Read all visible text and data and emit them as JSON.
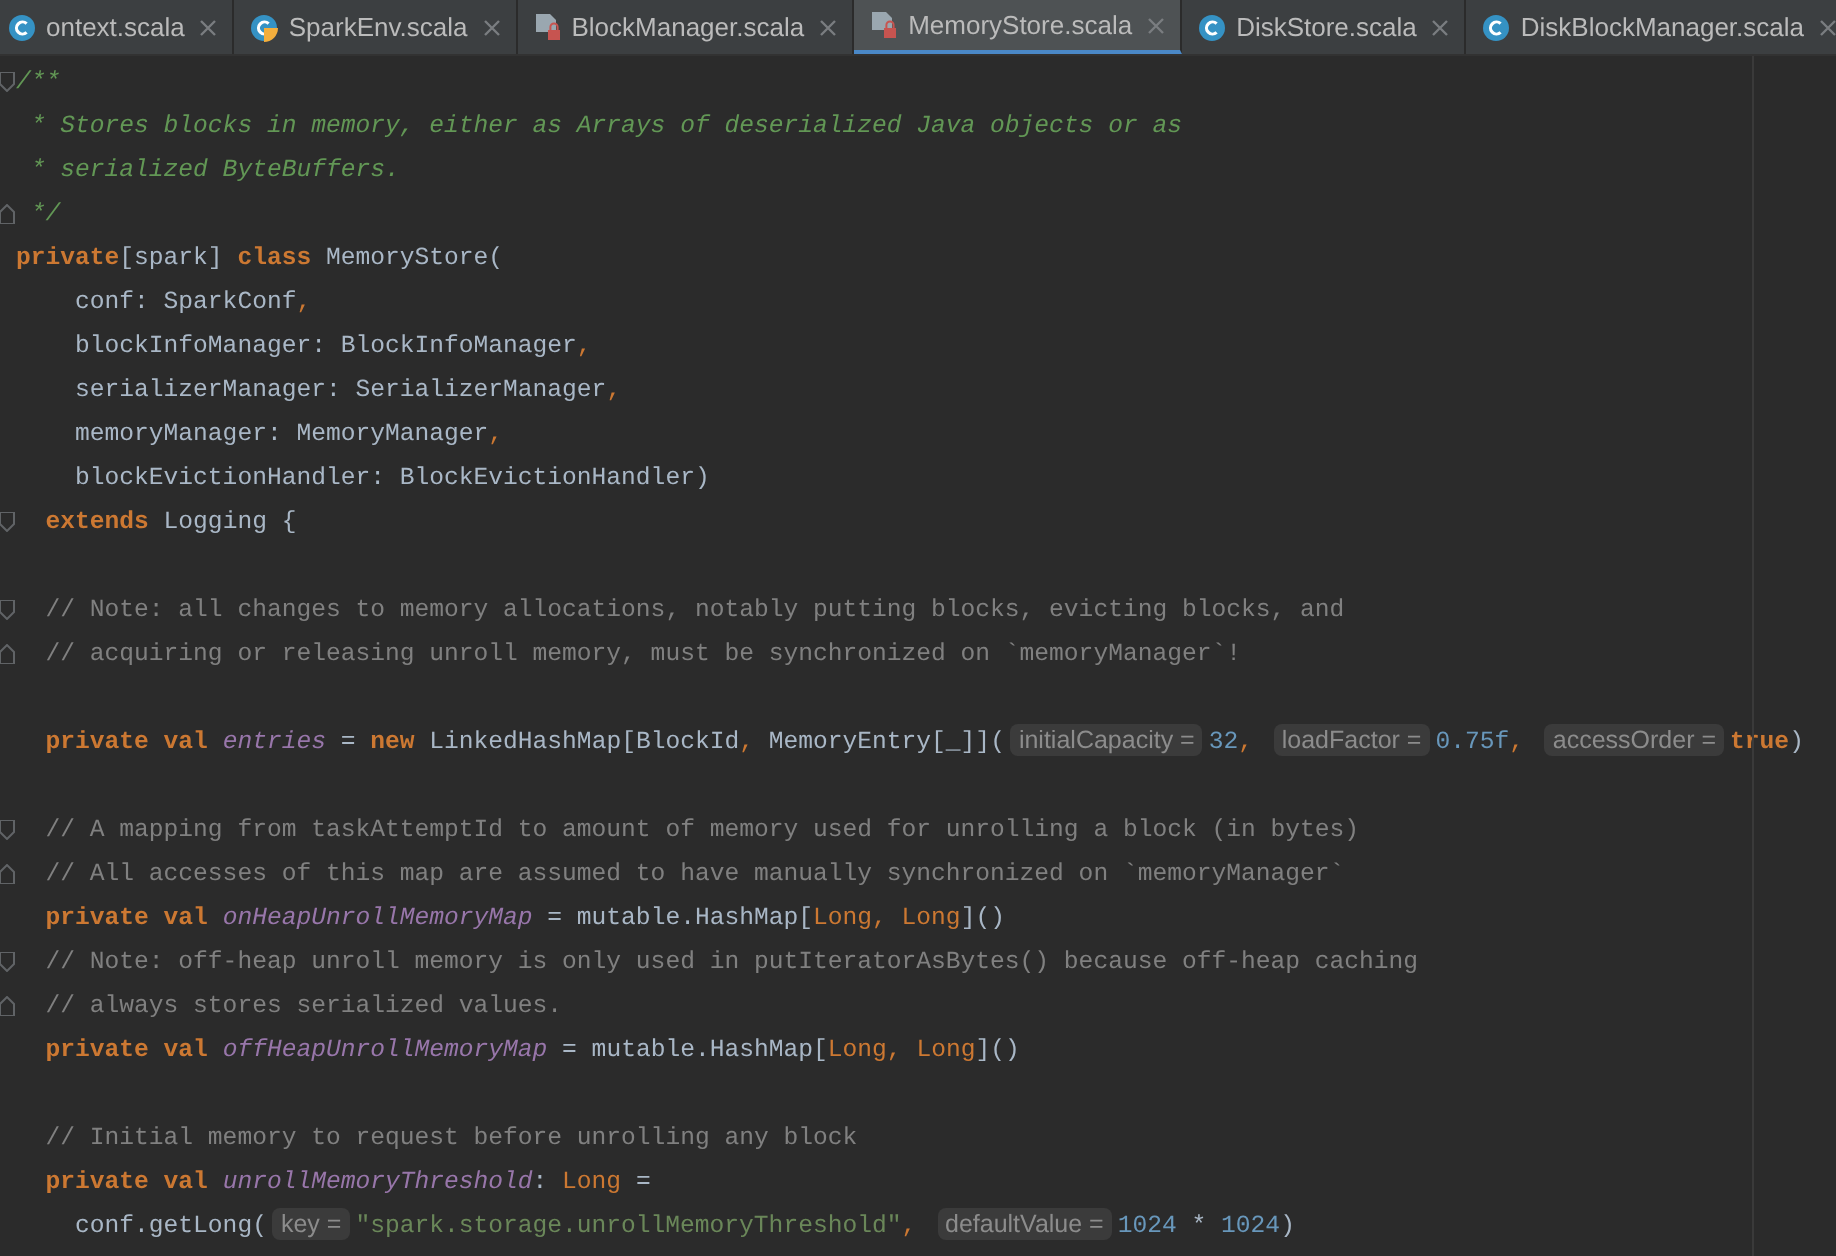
{
  "tabs": [
    {
      "label": "ontext.scala",
      "kind": "class",
      "selected": false
    },
    {
      "label": "SparkEnv.scala",
      "kind": "object",
      "selected": false
    },
    {
      "label": "BlockManager.scala",
      "kind": "locked",
      "selected": false
    },
    {
      "label": "MemoryStore.scala",
      "kind": "locked",
      "selected": true
    },
    {
      "label": "DiskStore.scala",
      "kind": "class",
      "selected": false
    },
    {
      "label": "DiskBlockManager.scala",
      "kind": "class",
      "selected": false
    }
  ],
  "lines": [
    {
      "kind": "code",
      "fold_start": true,
      "tokens": [
        {
          "kind": "doc",
          "text": "/**"
        }
      ]
    },
    {
      "kind": "code",
      "tokens": [
        {
          "kind": "doc",
          "text": " * Stores blocks in memory, either as Arrays of deserialized Java objects or as"
        }
      ]
    },
    {
      "kind": "code",
      "tokens": [
        {
          "kind": "doc",
          "text": " * serialized ByteBuffers."
        }
      ]
    },
    {
      "kind": "code",
      "fold_end": true,
      "tokens": [
        {
          "kind": "doc",
          "text": " */"
        }
      ]
    },
    {
      "kind": "code",
      "tokens": [
        {
          "kind": "kw",
          "text": "private"
        },
        {
          "kind": "plain",
          "text": "[spark] "
        },
        {
          "kind": "kw",
          "text": "class "
        },
        {
          "kind": "plain",
          "text": "MemoryStore("
        }
      ]
    },
    {
      "kind": "code",
      "tokens": [
        {
          "kind": "plain",
          "text": "    conf: SparkConf"
        },
        {
          "kind": "punct",
          "text": ","
        }
      ]
    },
    {
      "kind": "code",
      "tokens": [
        {
          "kind": "plain",
          "text": "    blockInfoManager: BlockInfoManager"
        },
        {
          "kind": "punct",
          "text": ","
        }
      ]
    },
    {
      "kind": "code",
      "tokens": [
        {
          "kind": "plain",
          "text": "    serializerManager: SerializerManager"
        },
        {
          "kind": "punct",
          "text": ","
        }
      ]
    },
    {
      "kind": "code",
      "tokens": [
        {
          "kind": "plain",
          "text": "    memoryManager: MemoryManager"
        },
        {
          "kind": "punct",
          "text": ","
        }
      ]
    },
    {
      "kind": "code",
      "tokens": [
        {
          "kind": "plain",
          "text": "    blockEvictionHandler: BlockEvictionHandler)"
        }
      ]
    },
    {
      "kind": "code",
      "fold_start": true,
      "tokens": [
        {
          "kind": "kw",
          "text": "  extends "
        },
        {
          "kind": "plain",
          "text": "Logging {"
        }
      ]
    },
    {
      "kind": "blank"
    },
    {
      "kind": "code",
      "fold_start": true,
      "tokens": [
        {
          "kind": "comment",
          "text": "  // Note: all changes to memory allocations, notably putting blocks, evicting blocks, and"
        }
      ]
    },
    {
      "kind": "code",
      "fold_end": true,
      "tokens": [
        {
          "kind": "comment",
          "text": "  // acquiring or releasing unroll memory, must be synchronized on `memoryManager`!"
        }
      ]
    },
    {
      "kind": "blank"
    },
    {
      "kind": "code",
      "tokens": [
        {
          "kind": "kw",
          "text": "  private val "
        },
        {
          "kind": "field",
          "text": "entries"
        },
        {
          "kind": "plain",
          "text": " = "
        },
        {
          "kind": "kw",
          "text": "new "
        },
        {
          "kind": "plain",
          "text": "LinkedHashMap[BlockId"
        },
        {
          "kind": "punct",
          "text": ", "
        },
        {
          "kind": "plain",
          "text": "MemoryEntry[_]]("
        },
        {
          "kind": "hint",
          "text": "initialCapacity ="
        },
        {
          "kind": "num",
          "text": "32"
        },
        {
          "kind": "punct",
          "text": ", "
        },
        {
          "kind": "hint",
          "text": "loadFactor ="
        },
        {
          "kind": "num",
          "text": "0.75f"
        },
        {
          "kind": "punct",
          "text": ", "
        },
        {
          "kind": "hint",
          "text": "accessOrder ="
        },
        {
          "kind": "kw",
          "text": "true"
        },
        {
          "kind": "plain",
          "text": ")"
        }
      ]
    },
    {
      "kind": "blank"
    },
    {
      "kind": "code",
      "fold_start": true,
      "tokens": [
        {
          "kind": "comment",
          "text": "  // A mapping from taskAttemptId to amount of memory used for unrolling a block (in bytes)"
        }
      ]
    },
    {
      "kind": "code",
      "fold_end": true,
      "tokens": [
        {
          "kind": "comment",
          "text": "  // All accesses of this map are assumed to have manually synchronized on `memoryManager`"
        }
      ]
    },
    {
      "kind": "code",
      "tokens": [
        {
          "kind": "kw",
          "text": "  private val "
        },
        {
          "kind": "field",
          "text": "onHeapUnrollMemoryMap"
        },
        {
          "kind": "plain",
          "text": " = mutable.HashMap["
        },
        {
          "kind": "kw2",
          "text": "Long"
        },
        {
          "kind": "punct",
          "text": ", "
        },
        {
          "kind": "kw2",
          "text": "Long"
        },
        {
          "kind": "plain",
          "text": "]()"
        }
      ]
    },
    {
      "kind": "code",
      "fold_start": true,
      "tokens": [
        {
          "kind": "comment",
          "text": "  // Note: off-heap unroll memory is only used in putIteratorAsBytes() because off-heap caching"
        }
      ]
    },
    {
      "kind": "code",
      "fold_end": true,
      "tokens": [
        {
          "kind": "comment",
          "text": "  // always stores serialized values."
        }
      ]
    },
    {
      "kind": "code",
      "tokens": [
        {
          "kind": "kw",
          "text": "  private val "
        },
        {
          "kind": "field",
          "text": "offHeapUnrollMemoryMap"
        },
        {
          "kind": "plain",
          "text": " = mutable.HashMap["
        },
        {
          "kind": "kw2",
          "text": "Long"
        },
        {
          "kind": "punct",
          "text": ", "
        },
        {
          "kind": "kw2",
          "text": "Long"
        },
        {
          "kind": "plain",
          "text": "]()"
        }
      ]
    },
    {
      "kind": "blank"
    },
    {
      "kind": "code",
      "tokens": [
        {
          "kind": "comment",
          "text": "  // Initial memory to request before unrolling any block"
        }
      ]
    },
    {
      "kind": "code",
      "tokens": [
        {
          "kind": "kw",
          "text": "  private val "
        },
        {
          "kind": "field",
          "text": "unrollMemoryThreshold"
        },
        {
          "kind": "plain",
          "text": ": "
        },
        {
          "kind": "kw2",
          "text": "Long"
        },
        {
          "kind": "plain",
          "text": " ="
        }
      ]
    },
    {
      "kind": "code",
      "tokens": [
        {
          "kind": "plain",
          "text": "    conf.getLong("
        },
        {
          "kind": "hint",
          "text": "key ="
        },
        {
          "kind": "str",
          "text": "\"spark.storage.unrollMemoryThreshold\""
        },
        {
          "kind": "punct",
          "text": ", "
        },
        {
          "kind": "hint",
          "text": "defaultValue ="
        },
        {
          "kind": "num",
          "text": "1024"
        },
        {
          "kind": "plain",
          "text": " * "
        },
        {
          "kind": "num",
          "text": "1024"
        },
        {
          "kind": "plain",
          "text": ")"
        }
      ]
    }
  ]
}
